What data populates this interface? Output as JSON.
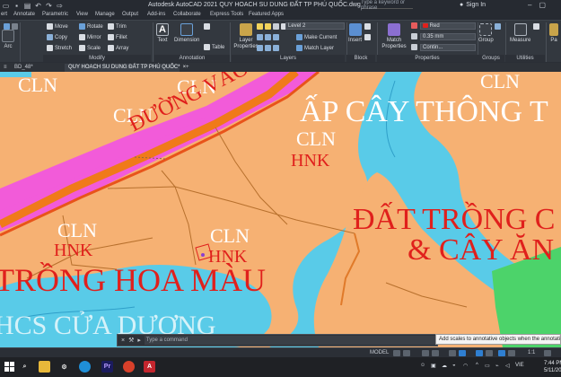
{
  "app": {
    "title": "Autodesk AutoCAD 2021   QUY HOACH SU DUNG ĐẤT TP PHÚ QUỐC.dwg",
    "search_placeholder": "Type a keyword or phrase",
    "sign_in": "Sign In"
  },
  "menu_tabs": [
    "ert",
    "Annotate",
    "Parametric",
    "View",
    "Manage",
    "Output",
    "Add-ins",
    "Collaborate",
    "Express Tools",
    "Featured Apps"
  ],
  "ribbon": {
    "modify_tools": [
      [
        "Move",
        "Rotate",
        "Trim"
      ],
      [
        "Copy",
        "Mirror",
        "Fillet"
      ],
      [
        "Stretch",
        "Scale",
        "Array"
      ]
    ],
    "left_tools": [
      "Arc"
    ],
    "annotation": {
      "text": "Text",
      "dimension": "Dimension",
      "table": "Table"
    },
    "layers": {
      "layer_properties": "Layer Properties",
      "current_layer": "Level 2",
      "make_current": "Make Current",
      "match_layer": "Match Layer"
    },
    "block": {
      "insert": "Insert"
    },
    "properties": {
      "match_properties": "Match Properties",
      "color": "Red",
      "lineweight": "0.35 mm",
      "linetype": "Contin..."
    },
    "groups": {
      "group": "Group"
    },
    "utilities": {
      "measure": "Measure"
    },
    "extra_tool": "Pa",
    "panels": [
      "Modify",
      "Annotation",
      "Layers",
      "Block",
      "Properties",
      "Groups",
      "Utilities"
    ]
  },
  "doc_tabs": [
    "BD_48*",
    "QUY HOACH SU DUNG ĐẤT TP PHÚ QUỐC*"
  ],
  "drawing": {
    "labels": {
      "cln1": "CLN",
      "cln2": "CLN",
      "cln3": "CLN",
      "cln4": "CLN",
      "cln5": "CLN",
      "cln6": "CLN",
      "cln7": "CLN",
      "hnk1": "HNK",
      "hnk2": "HNK",
      "hnk3": "HNK",
      "road": "ĐƯỜNG VÀO KH",
      "ap_cay_thong": "ẤP CÂY THÔNG T",
      "dat_trong_1": "ĐẤT TRỒNG C",
      "dat_trong_2": "& CÂY ĂN",
      "trong_hoa_mau": "TRỒNG HOA MÀU",
      "thcs": "HCS CỬA DƯƠNG"
    },
    "colors": {
      "orange": "#f6b173",
      "cyan": "#59cbe8",
      "magenta": "#f25bd9",
      "red_text": "#e0201c",
      "white_text": "#ffffff",
      "green": "#4cd36a"
    }
  },
  "command_line": {
    "prompt": "Type a command"
  },
  "tooltip": "Add scales to annotative objects when the annotation scale changes",
  "status_bar": {
    "model": "MODEL",
    "scale": "1:1"
  },
  "taskbar": {
    "time": "7:44 PM",
    "date": "5/11/2021",
    "lang": "VIE"
  }
}
